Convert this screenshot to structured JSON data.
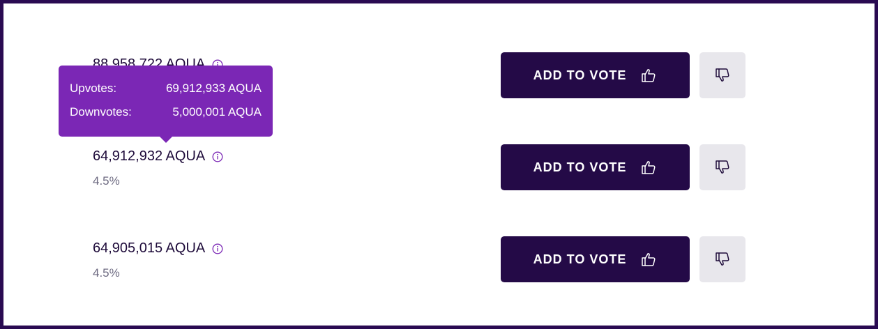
{
  "rows": [
    {
      "amount": "88,958,722 AQUA",
      "percent": "",
      "vote_label": "ADD TO VOTE"
    },
    {
      "amount": "64,912,932 AQUA",
      "percent": "4.5%",
      "vote_label": "ADD TO VOTE"
    },
    {
      "amount": "64,905,015 AQUA",
      "percent": "4.5%",
      "vote_label": "ADD TO VOTE"
    }
  ],
  "tooltip": {
    "upvotes_label": "Upvotes:",
    "upvotes_value": "69,912,933 AQUA",
    "downvotes_label": "Downvotes:",
    "downvotes_value": "5,000,001 AQUA"
  },
  "colors": {
    "border": "#2a0b52",
    "button_primary": "#240a47",
    "button_secondary": "#e8e7ec",
    "tooltip": "#7b27b5",
    "info_icon": "#7b27b5",
    "text_primary": "#1e0b3a",
    "text_secondary": "#6c6980"
  },
  "icons": {
    "info": "info-icon",
    "vote_up": "thumb-up-icon",
    "vote_down": "thumb-down-icon"
  }
}
